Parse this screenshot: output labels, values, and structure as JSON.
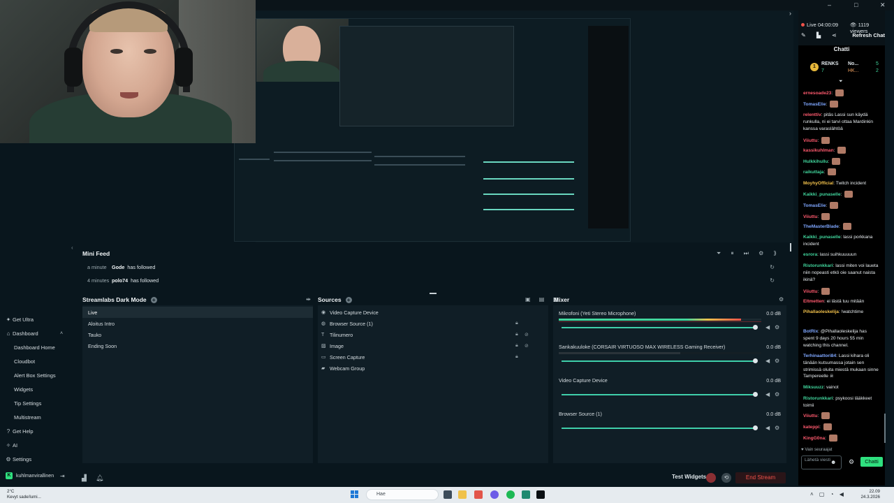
{
  "window": {
    "minimize": "–",
    "maximize": "□",
    "close": "✕"
  },
  "minifeed": {
    "title": "Mini Feed",
    "events": [
      {
        "time": "a minute",
        "user": "Gode",
        "action": "has followed"
      },
      {
        "time": "4 minutes",
        "user": "polo74",
        "action": "has followed"
      }
    ]
  },
  "scenes": {
    "title": "Streamlabs Dark Mode",
    "items": [
      "Live",
      "Aloitus Intro",
      "Tauko",
      "Ending Soon"
    ]
  },
  "sources": {
    "title": "Sources",
    "items": [
      "Video Capture Device",
      "Browser Source (1)",
      "Tilinumero",
      "Image",
      "Screen Capture",
      "Webcam Group"
    ]
  },
  "mixer": {
    "title": "Mixer",
    "channels": [
      {
        "name": "Mikrofoni (Yeti Stereo Microphone)",
        "db": "0.0 dB",
        "level": 0.9
      },
      {
        "name": "Sankakuuloke (CORSAIR VIRTUOSO MAX WIRELESS Gaming Receiver)",
        "db": "0.0 dB",
        "level": 0.6
      },
      {
        "name": "Video Capture Device",
        "db": "0.0 dB",
        "level": 0.0
      },
      {
        "name": "Browser Source (1)",
        "db": "0.0 dB",
        "level": 0.0
      }
    ]
  },
  "nav": {
    "items": [
      "Get Ultra",
      "Dashboard",
      "Dashboard Home",
      "Cloudbot",
      "Alert Box Settings",
      "Widgets",
      "Tip Settings",
      "Multistream",
      "Get Help",
      "AI",
      "Settings"
    ],
    "account": "kuhlmanvirallinen"
  },
  "footer": {
    "test_widgets": "Test Widgets",
    "end_stream": "End Stream"
  },
  "chat": {
    "live": "Live 04:00:09",
    "viewers": "1119 viewers",
    "refresh": "Refresh Chat",
    "title": "Chatti",
    "leaderboard": {
      "first": "RENKS",
      "first_val": "7",
      "second": "No...",
      "second_val": "5",
      "third": "HK...",
      "third_val": "2"
    },
    "messages": [
      {
        "user": "ernesoade23",
        "text": "",
        "color": "#ff5a6e"
      },
      {
        "user": "TomasElie",
        "text": "",
        "color": "#7fa7ff"
      },
      {
        "user": "relenttiv",
        "text": "pitäs Lassi sun käydä runkulla, ni ei tarvi ottaa Mardinkin kanssa varaslähtöä",
        "color": "#ff5a6e"
      },
      {
        "user": "Viiuttu",
        "text": "",
        "color": "#ff5a6e"
      },
      {
        "user": "kassikuhlman",
        "text": "",
        "color": "#ff5a6e"
      },
      {
        "user": "Hulkkihullu",
        "text": "",
        "color": "#41d69d"
      },
      {
        "user": "raikuttaja",
        "text": "",
        "color": "#41d69d"
      },
      {
        "user": "MoyhyOfficial",
        "text": "Twitch incident",
        "color": "#f2c14b"
      },
      {
        "user": "Kaikki_punaselle",
        "text": "",
        "color": "#41d69d"
      },
      {
        "user": "TomasElie",
        "text": "",
        "color": "#7fa7ff"
      },
      {
        "user": "Viiuttu",
        "text": "",
        "color": "#ff5a6e"
      },
      {
        "user": "TheMasterBlade",
        "text": "",
        "color": "#7fa7ff"
      },
      {
        "user": "Kaikki_punaselle",
        "text": "lassi porkkana incident",
        "color": "#41d69d"
      },
      {
        "user": "esrora",
        "text": "lassi suihkuuuuun",
        "color": "#41d69d"
      },
      {
        "user": "Ristorunkkari",
        "text": "lassi miten voi laueta niin nopeasti etkö oie saanut naista ikinä?",
        "color": "#41d69d"
      },
      {
        "user": "Viiuttu",
        "text": "",
        "color": "#ff5a6e"
      },
      {
        "user": "Eltmetten",
        "text": "ei lästä tuu mitään",
        "color": "#ff5a6e"
      },
      {
        "user": "Pihallaoleskelija",
        "text": "!watchtime",
        "color": "#f2c14b"
      },
      {
        "user": "BotRix",
        "text": "@Pihallaoleskelija has spent 9 days 20 hours 55 min watching this channel.",
        "color": "#7fa7ff"
      },
      {
        "user": "Terhinaattori84",
        "text": "Lassi kihara oli tänään kutsumassa jotain sen strimissä oluita miestä mukaan sinne Tampereelle ☠",
        "color": "#7fa7ff"
      },
      {
        "user": "Miksuuzz",
        "text": "vainot",
        "color": "#41d69d"
      },
      {
        "user": "Ristorunkkari",
        "text": "psykoosi lääkkeet toimii",
        "color": "#41d69d"
      },
      {
        "user": "Viiuttu",
        "text": "",
        "color": "#ff5a6e"
      },
      {
        "user": "kateppi",
        "text": "",
        "color": "#ff5a6e"
      },
      {
        "user": "KingG0na",
        "text": "",
        "color": "#ff5a6e"
      }
    ],
    "subscribers_only": "Vain seuraajat",
    "input_placeholder": "Lähetä viesti",
    "send": "Chatti"
  },
  "taskbar": {
    "weather_temp": "2°C",
    "weather_text": "Kevyt sade/lumi...",
    "search": "Hae",
    "time": "22.09",
    "date": "24.3.2026"
  }
}
